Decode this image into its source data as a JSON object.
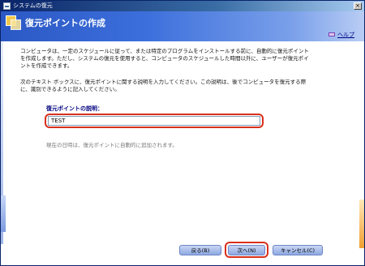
{
  "window": {
    "title": "システムの復元",
    "close_glyph": "×"
  },
  "header": {
    "title": "復元ポイントの作成"
  },
  "help": {
    "label": "ヘルプ"
  },
  "content": {
    "paragraph1": "コンピュータは、一定のスケジュールに従って、または特定のプログラムをインストールする前に、自動的に復元ポイントを作成します。ただし、システムの復元を使用すると、コンピュータのスケジュールした時間以外に、ユーザーが復元ポイントを作成できます。",
    "paragraph2": "次のテキスト ボックスに、復元ポイントに関する説明を入力してください。この説明は、後でコンピュータを復元する際に、識別できるように記入してください。",
    "field_label": "復元ポイントの説明：",
    "field_value": "TEST",
    "note": "現在の日時は、復元ポイントに自動的に追加されます。"
  },
  "buttons": {
    "back": "戻る(B)",
    "next": "次へ(N)",
    "cancel": "キャンセル(C)"
  },
  "colors": {
    "highlight": "#d9301b",
    "header": "#2b58c4",
    "button": "#8ea8e1"
  }
}
